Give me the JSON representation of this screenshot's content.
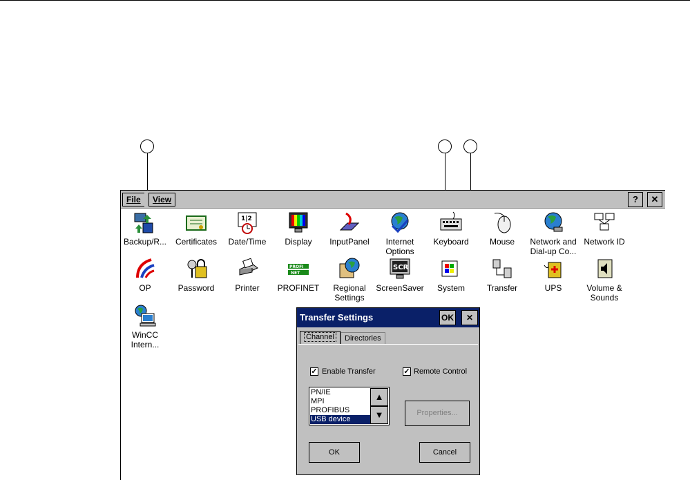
{
  "callouts": [
    "",
    "",
    ""
  ],
  "menu": {
    "file": "File",
    "view": "View"
  },
  "window_buttons": {
    "help": "?",
    "close": "✕"
  },
  "icons": [
    {
      "label": "Backup/R...",
      "icon": "backup-restore-icon"
    },
    {
      "label": "Certificates",
      "icon": "certificates-icon"
    },
    {
      "label": "Date/Time",
      "icon": "date-time-icon"
    },
    {
      "label": "Display",
      "icon": "display-icon"
    },
    {
      "label": "InputPanel",
      "icon": "input-panel-icon"
    },
    {
      "label": "Internet\nOptions",
      "icon": "internet-options-icon"
    },
    {
      "label": "Keyboard",
      "icon": "keyboard-icon"
    },
    {
      "label": "Mouse",
      "icon": "mouse-icon"
    },
    {
      "label": "Network and\nDial-up Co...",
      "icon": "network-dialup-icon"
    },
    {
      "label": "Network ID",
      "icon": "network-id-icon"
    },
    {
      "label": "OP",
      "icon": "op-icon"
    },
    {
      "label": "Password",
      "icon": "password-icon"
    },
    {
      "label": "Printer",
      "icon": "printer-icon"
    },
    {
      "label": "PROFINET",
      "icon": "profinet-icon"
    },
    {
      "label": "Regional\nSettings",
      "icon": "regional-settings-icon"
    },
    {
      "label": "ScreenSaver",
      "icon": "screensaver-icon"
    },
    {
      "label": "System",
      "icon": "system-icon"
    },
    {
      "label": "Transfer",
      "icon": "transfer-icon"
    },
    {
      "label": "UPS",
      "icon": "ups-icon"
    },
    {
      "label": "Volume &\nSounds",
      "icon": "volume-sounds-icon"
    },
    {
      "label": "WinCC\nIntern...",
      "icon": "wincc-internet-icon"
    }
  ],
  "dialog": {
    "title": "Transfer Settings",
    "ok_title_button": "OK",
    "close_title_button": "✕",
    "tabs": [
      "Channel",
      "Directories"
    ],
    "enable_transfer": {
      "label": "Enable Transfer",
      "checked": true
    },
    "remote_control": {
      "label": "Remote Control",
      "checked": true
    },
    "channels": [
      "PN/IE",
      "MPI",
      "PROFIBUS",
      "USB device"
    ],
    "selected_channel": "USB device",
    "properties_button": "Properties...",
    "ok_button": "OK",
    "cancel_button": "Cancel"
  },
  "colors": {
    "dialog_title_bg": "#0a2068",
    "selection_bg": "#0a2068",
    "chrome": "#c0c0c0"
  }
}
